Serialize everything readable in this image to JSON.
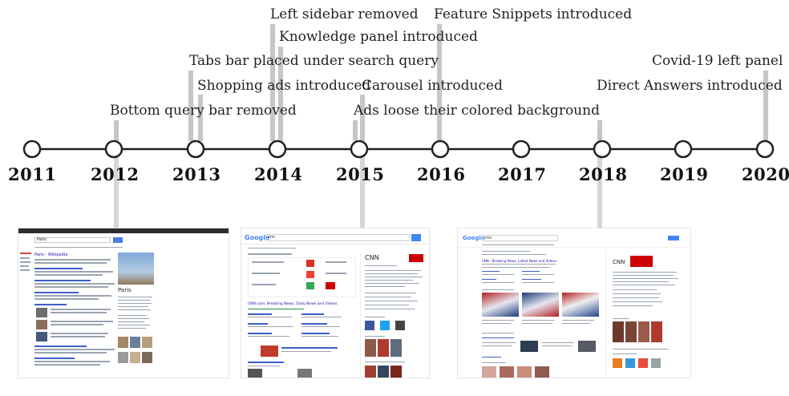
{
  "timeline": {
    "years": [
      "2011",
      "2012",
      "2013",
      "2014",
      "2015",
      "2016",
      "2017",
      "2018",
      "2019",
      "2020"
    ],
    "events": [
      {
        "label": "Bottom query bar removed"
      },
      {
        "label": "Tabs bar placed under search query"
      },
      {
        "label": "Shopping ads introduced"
      },
      {
        "label": "Left sidebar removed"
      },
      {
        "label": "Knowledge panel introduced"
      },
      {
        "label": "Carousel introduced"
      },
      {
        "label": "Ads loose their colored background"
      },
      {
        "label": "Feature Snippets introduced"
      },
      {
        "label": "Direct Answers introduced"
      },
      {
        "label": "Covid-19 left panel"
      }
    ]
  },
  "screenshots": [
    {
      "query": "Paris",
      "panel_title": "Paris",
      "top_result": "Paris - Wikipedia"
    },
    {
      "logo": "Google",
      "query": "cnn",
      "panel_title": "CNN",
      "top_result": "CNN.com: Breaking News, Daily News and Videos"
    },
    {
      "logo": "Google",
      "query": "cnn",
      "panel_title": "CNN",
      "top_result": "CNN - Breaking News, Latest News and Videos"
    }
  ]
}
